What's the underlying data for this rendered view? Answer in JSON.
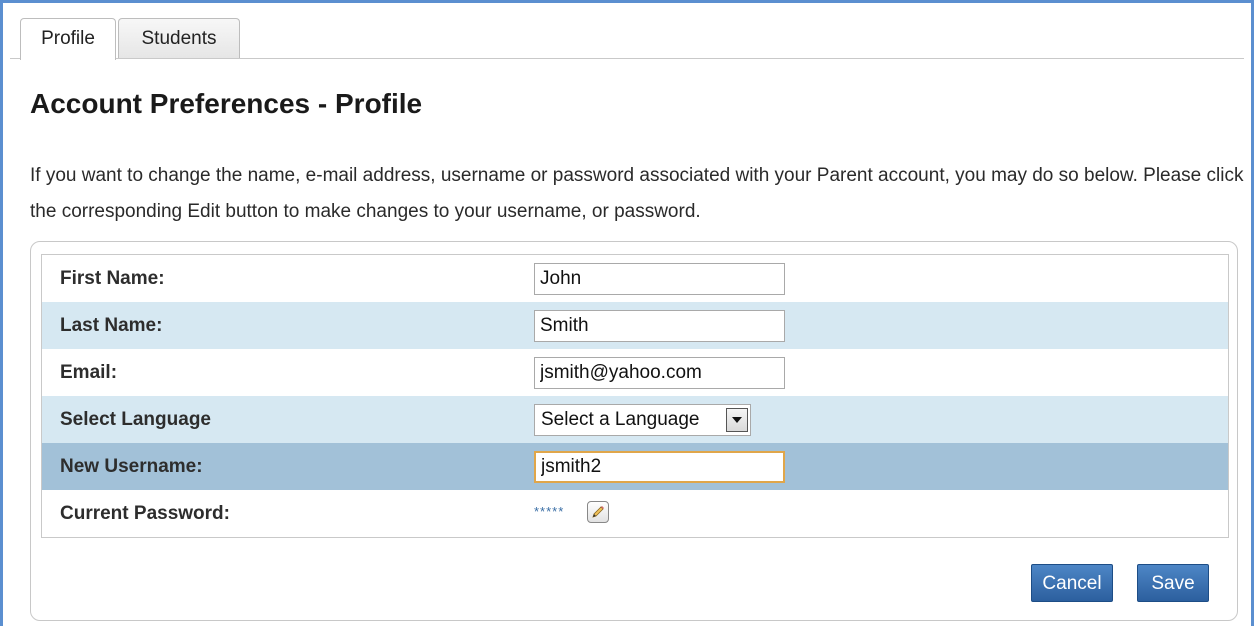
{
  "tabs": [
    {
      "label": "Profile",
      "active": true
    },
    {
      "label": "Students",
      "active": false
    }
  ],
  "page_title": "Account Preferences - Profile",
  "intro": "If you want to change the name, e-mail address, username or password associated with your Parent account, you may do so below. Please click the corresponding Edit button to make changes to your username, or password.",
  "form": {
    "first_name": {
      "label": "First Name:",
      "value": "John"
    },
    "last_name": {
      "label": "Last Name:",
      "value": "Smith"
    },
    "email": {
      "label": "Email:",
      "value": "jsmith@yahoo.com"
    },
    "language": {
      "label": "Select Language",
      "selected": "Select a Language"
    },
    "new_username": {
      "label": "New Username:",
      "value": "jsmith2"
    },
    "current_password": {
      "label": "Current Password:",
      "masked": "*****"
    }
  },
  "buttons": {
    "cancel": "Cancel",
    "save": "Save"
  },
  "colors": {
    "accent": "#2c5f9e",
    "row_alt": "#d6e8f2",
    "row_selected": "#a2c1d8",
    "focus_border": "#e0a64a"
  },
  "icons": {
    "password_edit": "pencil-icon",
    "language_dropdown": "chevron-down-icon"
  }
}
